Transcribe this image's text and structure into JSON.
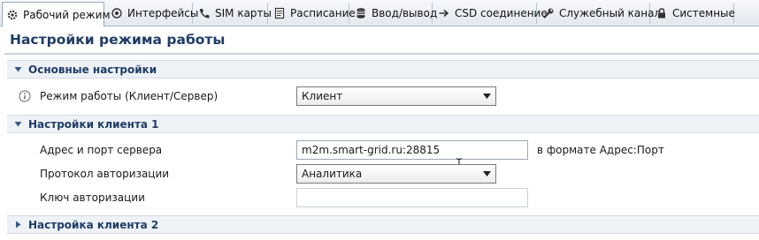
{
  "tabs": [
    {
      "label": "Рабочий режим",
      "icon": "gear-icon",
      "active": true
    },
    {
      "label": "Интерфейсы",
      "icon": "network-icon"
    },
    {
      "label": "SIM карты",
      "icon": "phone-icon"
    },
    {
      "label": "Расписание",
      "icon": "schedule-icon"
    },
    {
      "label": "Ввод/вывод",
      "icon": "database-icon"
    },
    {
      "label": "CSD соединение",
      "icon": "arrow-right-icon"
    },
    {
      "label": "Служебный канал",
      "icon": "wrench-icon"
    },
    {
      "label": "Системные",
      "icon": "lock-icon"
    }
  ],
  "page": {
    "title": "Настройки режима работы"
  },
  "sections": {
    "basic": {
      "title": "Основные настройки",
      "mode_label": "Режим работы (Клиент/Сервер)",
      "mode_value": "Клиент"
    },
    "client1": {
      "title": "Настройки клиента 1",
      "server_label": "Адрес и порт сервера",
      "server_value": "m2m.smart-grid.ru:28815",
      "server_hint": "в формате Адрес:Порт",
      "auth_protocol_label": "Протокол авторизации",
      "auth_protocol_value": "Аналитика",
      "auth_key_label": "Ключ авторизации",
      "auth_key_value": ""
    },
    "client2": {
      "title": "Настройка клиента 2"
    }
  },
  "colors": {
    "title": "#1f3d66",
    "section_bg": "#eef2f7",
    "tab_bar": "#e3e8ef"
  }
}
